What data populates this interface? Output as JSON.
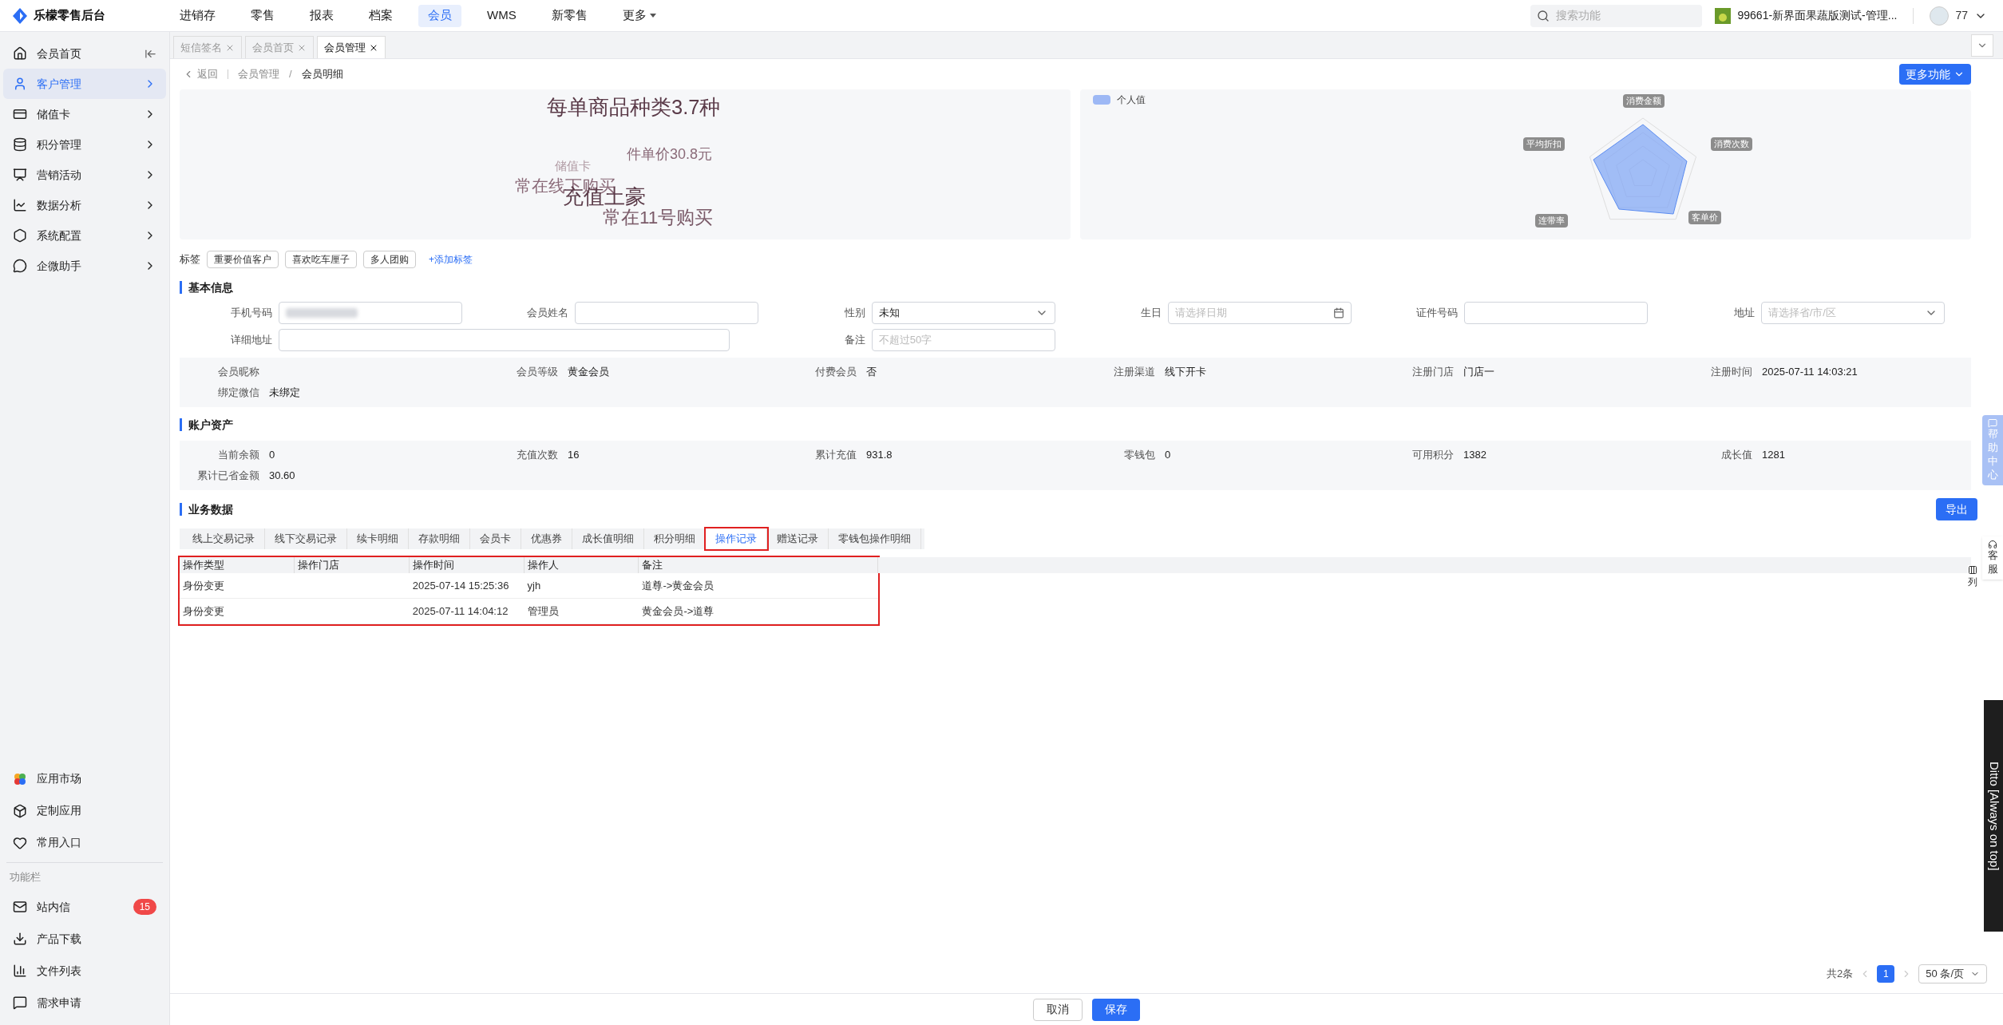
{
  "brand": "乐檬零售后台",
  "top_nav": [
    {
      "label": "进销存",
      "selected": false
    },
    {
      "label": "零售",
      "selected": false
    },
    {
      "label": "报表",
      "selected": false
    },
    {
      "label": "档案",
      "selected": false
    },
    {
      "label": "会员",
      "selected": true
    },
    {
      "label": "WMS",
      "selected": false
    },
    {
      "label": "新零售",
      "selected": false
    },
    {
      "label": "更多",
      "selected": false,
      "kind": "dropdown"
    }
  ],
  "search": {
    "placeholder": "搜索功能"
  },
  "store": "99661-新界面果蔬版测试-管理...",
  "user": "77",
  "sidebar": {
    "items": [
      {
        "label": "会员首页",
        "selected": false,
        "kind": "collapse"
      },
      {
        "label": "客户管理",
        "selected": true,
        "kind": "menu"
      },
      {
        "label": "储值卡",
        "selected": false,
        "kind": "menu"
      },
      {
        "label": "积分管理",
        "selected": false,
        "kind": "menu"
      },
      {
        "label": "营销活动",
        "selected": false,
        "kind": "menu"
      },
      {
        "label": "数据分析",
        "selected": false,
        "kind": "menu"
      },
      {
        "label": "系统配置",
        "selected": false,
        "kind": "menu"
      },
      {
        "label": "企微助手",
        "selected": false,
        "kind": "menu"
      }
    ],
    "apps": [
      {
        "label": "应用市场"
      },
      {
        "label": "定制应用"
      },
      {
        "label": "常用入口"
      }
    ],
    "section_title": "功能栏",
    "tools": [
      {
        "label": "站内信",
        "badge": "15"
      },
      {
        "label": "产品下载"
      },
      {
        "label": "文件列表"
      },
      {
        "label": "需求申请"
      }
    ]
  },
  "page_tabs": [
    {
      "label": "短信签名",
      "selected": false
    },
    {
      "label": "会员首页",
      "selected": false
    },
    {
      "label": "会员管理",
      "selected": true
    }
  ],
  "breadcrumb": {
    "back": "返回",
    "separator": "/",
    "items": [
      "会员管理",
      "会员明细"
    ]
  },
  "more_button": "更多功能",
  "word_cloud": [
    "每单商品种类3.7种",
    "件单价30.8元",
    "储值卡",
    "常在线下购买",
    "充值土豪",
    "常在11号购买"
  ],
  "radar": {
    "legend": "个人值",
    "labels": [
      "消费金额",
      "消费次数",
      "客单价",
      "连带率",
      "平均折扣"
    ]
  },
  "tags": {
    "label": "标签",
    "items": [
      "重要价值客户",
      "喜欢吃车厘子",
      "多人团购"
    ],
    "add": "+添加标签"
  },
  "basic_info": {
    "title": "基本信息",
    "fields": [
      {
        "label": "手机号码",
        "kind": "masked"
      },
      {
        "label": "会员姓名",
        "kind": "text"
      },
      {
        "label": "性别",
        "kind": "select",
        "value": "未知"
      },
      {
        "label": "生日",
        "kind": "date",
        "placeholder": "请选择日期"
      },
      {
        "label": "证件号码",
        "kind": "text"
      },
      {
        "label": "地址",
        "kind": "select",
        "placeholder": "请选择省/市/区"
      },
      {
        "label": "详细地址",
        "kind": "wide"
      },
      {
        "label": "备注",
        "kind": "text",
        "placeholder": "不超过50字"
      }
    ]
  },
  "profile": [
    {
      "label": "会员昵称"
    },
    {
      "label": "会员等级",
      "value": "黄金会员"
    },
    {
      "label": "付费会员",
      "value": "否"
    },
    {
      "label": "注册渠道",
      "value": "线下开卡"
    },
    {
      "label": "注册门店",
      "value": "门店一"
    },
    {
      "label": "注册时间",
      "value": "2025-07-11 14:03:21"
    },
    {
      "label": "绑定微信",
      "value": "未绑定"
    }
  ],
  "account": {
    "title": "账户资产",
    "items": [
      {
        "label": "当前余额",
        "value": "0"
      },
      {
        "label": "充值次数",
        "value": "16"
      },
      {
        "label": "累计充值",
        "value": "931.8"
      },
      {
        "label": "零钱包",
        "value": "0"
      },
      {
        "label": "可用积分",
        "value": "1382"
      },
      {
        "label": "成长值",
        "value": "1281"
      },
      {
        "label": "累计已省金额",
        "value": "30.60"
      }
    ]
  },
  "business": {
    "title": "业务数据",
    "export": "导出",
    "tabs": [
      {
        "label": "线上交易记录",
        "selected": false
      },
      {
        "label": "线下交易记录",
        "selected": false
      },
      {
        "label": "续卡明细",
        "selected": false
      },
      {
        "label": "存款明细",
        "selected": false
      },
      {
        "label": "会员卡",
        "selected": false
      },
      {
        "label": "优惠券",
        "selected": false
      },
      {
        "label": "成长值明细",
        "selected": false
      },
      {
        "label": "积分明细",
        "selected": false
      },
      {
        "label": "操作记录",
        "selected": true
      },
      {
        "label": "赠送记录",
        "selected": false
      },
      {
        "label": "零钱包操作明细",
        "selected": false
      }
    ],
    "table": {
      "highlighted": true,
      "columns": [
        "操作类型",
        "操作门店",
        "操作时间",
        "操作人",
        "备注"
      ],
      "rows": [
        [
          "身份变更",
          null,
          "2025-07-14 15:25:36",
          "yjh",
          "道尊->黄金会员"
        ],
        [
          "身份变更",
          null,
          "2025-07-11 14:04:12",
          "管理员",
          "黄金会员->道尊"
        ]
      ]
    },
    "column_settings": "列"
  },
  "pagination": {
    "total": "共2条",
    "pages": [
      {
        "label": "1",
        "selected": true
      }
    ],
    "page_size": "50 条/页"
  },
  "footer_buttons": [
    {
      "label": "取消",
      "kind": "default"
    },
    {
      "label": "保存",
      "kind": "primary"
    }
  ],
  "help_tab": "帮助中心",
  "service_tab": "客服",
  "overlay": "Ditto [Always on top]"
}
